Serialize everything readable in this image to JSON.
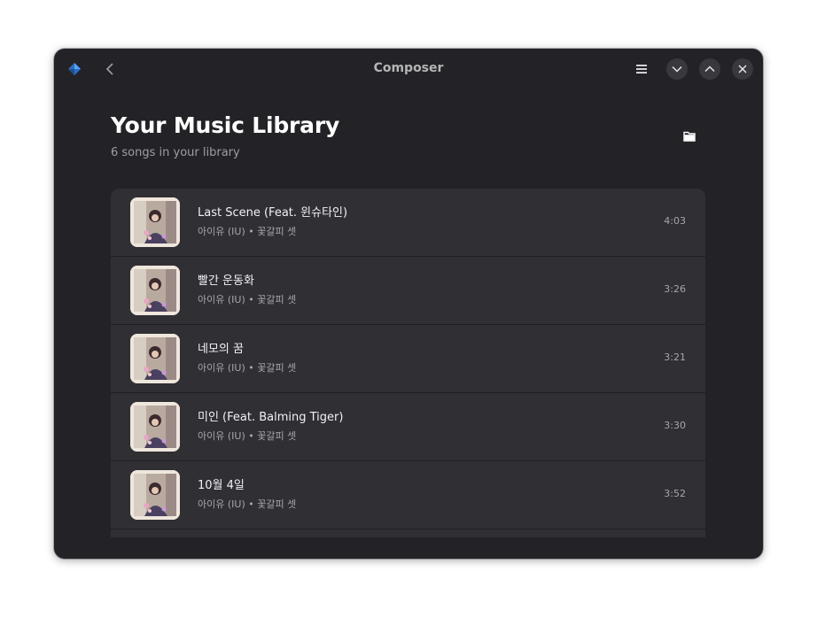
{
  "window": {
    "title": "Composer",
    "icons": {
      "app": "composer-app-icon",
      "back": "chevron-left-icon",
      "menu": "hamburger-menu-icon",
      "minimize": "chevron-down-icon",
      "maximize": "chevron-up-icon",
      "close": "close-icon"
    }
  },
  "header": {
    "title": "Your Music Library",
    "subtitle": "6 songs in your library",
    "folder_icon": "folder-icon"
  },
  "songs": [
    {
      "title": "Last Scene (Feat. 윈슈타인)",
      "artist": "아이유 (IU)",
      "album": "꽃갈피 셋",
      "duration": "4:03"
    },
    {
      "title": "빨간 운동화",
      "artist": "아이유 (IU)",
      "album": "꽃갈피 셋",
      "duration": "3:26"
    },
    {
      "title": "네모의 꿈",
      "artist": "아이유 (IU)",
      "album": "꽃갈피 셋",
      "duration": "3:21"
    },
    {
      "title": "미인 (Feat. Balming Tiger)",
      "artist": "아이유 (IU)",
      "album": "꽃갈피 셋",
      "duration": "3:30"
    },
    {
      "title": "10월 4일",
      "artist": "아이유 (IU)",
      "album": "꽃갈피 셋",
      "duration": "3:52"
    }
  ],
  "colors": {
    "window_bg": "#232327",
    "list_bg": "#2f2f34",
    "accent": "#3584e4"
  }
}
